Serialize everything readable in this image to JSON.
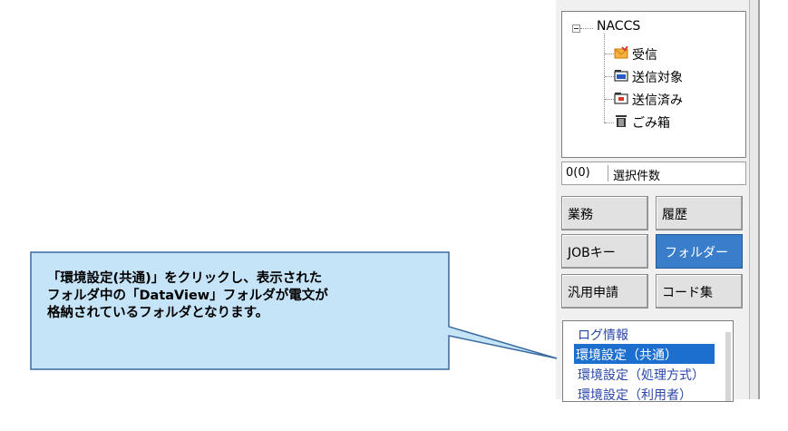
{
  "tree": {
    "root_label": "NACCS",
    "items": [
      {
        "label": "受信",
        "icon": "inbox-envelope-icon"
      },
      {
        "label": "送信対象",
        "icon": "outbox-tray-icon"
      },
      {
        "label": "送信済み",
        "icon": "sent-tray-icon"
      },
      {
        "label": "ごみ箱",
        "icon": "trash-icon"
      }
    ]
  },
  "selection": {
    "count": "0(0)",
    "label": "選択件数"
  },
  "buttons": {
    "gyomu": "業務",
    "rireki": "履歴",
    "jobkey": "JOBキー",
    "folder": "フォルダー",
    "hanyo": "汎用申請",
    "codeshu": "コード集"
  },
  "list": {
    "items": [
      "ログ情報",
      "環境設定（共通）",
      "環境設定（処理方式）",
      "環境設定（利用者）"
    ],
    "selected": "環境設定（共通）"
  },
  "callout": {
    "lines": [
      "「環境設定(共通)」をクリックし、表示された",
      "フォルダ中の「DataView」フォルダが電文が",
      "格納されているフォルダとなります。"
    ]
  },
  "colors": {
    "callout_fill": "#c5e4f7",
    "callout_border": "#3a6aa0",
    "active_button": "#3a7ecb",
    "selected_item": "#1d6fcf"
  }
}
